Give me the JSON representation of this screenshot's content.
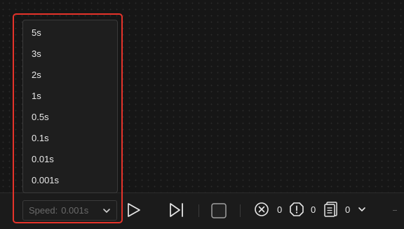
{
  "speed_menu": {
    "options": [
      "5s",
      "3s",
      "2s",
      "1s",
      "0.5s",
      "0.1s",
      "0.01s",
      "0.001s"
    ]
  },
  "toolbar": {
    "speed_label": "Speed:",
    "speed_value": "0.001s",
    "error_count": "0",
    "warning_count": "0",
    "log_count": "0",
    "icons": {
      "play": "play-icon",
      "step": "step-forward-icon",
      "stop": "stop-icon",
      "errors": "error-circle-icon",
      "warnings": "warning-octagon-icon",
      "logs": "document-icon",
      "logs_dropdown": "chevron-down-icon"
    }
  },
  "colors": {
    "background": "#161616",
    "highlight": "#e5332a",
    "text": "#e6e6e6",
    "muted_text": "#6a6a6a"
  }
}
